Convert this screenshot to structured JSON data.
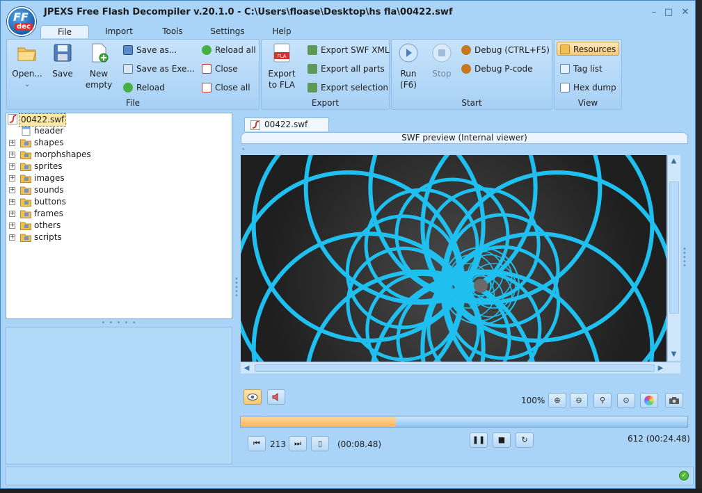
{
  "window": {
    "title": "JPEXS Free Flash Decompiler v.20.1.0 - C:\\Users\\floase\\Desktop\\hs fla\\00422.swf",
    "logo_top": "FF",
    "logo_bottom": "dec",
    "minimize_glyph": "–",
    "maximize_glyph": "□",
    "close_glyph": "✕"
  },
  "tabs": [
    {
      "label": "File",
      "active": true
    },
    {
      "label": "Import",
      "active": false
    },
    {
      "label": "Tools",
      "active": false
    },
    {
      "label": "Settings",
      "active": false
    },
    {
      "label": "Help",
      "active": false
    }
  ],
  "ribbon": {
    "file": {
      "label": "File",
      "open": "Open...",
      "save": "Save",
      "new_line1": "New",
      "new_line2": "empty",
      "save_as": "Save as...",
      "save_as_exe": "Save as Exe...",
      "reload": "Reload",
      "reload_all": "Reload all",
      "close": "Close",
      "close_all": "Close all"
    },
    "export": {
      "label": "Export",
      "fla_line1": "Export",
      "fla_line2": "to FLA",
      "fla_badge": "FLA",
      "swf_xml": "Export SWF XML",
      "all_parts": "Export all parts",
      "selection": "Export selection"
    },
    "start": {
      "label": "Start",
      "run_line1": "Run",
      "run_line2": "(F6)",
      "stop": "Stop",
      "debug": "Debug (CTRL+F5)",
      "debug_pcode": "Debug P-code"
    },
    "view": {
      "label": "View",
      "resources": "Resources",
      "tag_list": "Tag list",
      "hex_dump": "Hex dump"
    }
  },
  "tree": {
    "root": "00422.swf",
    "items": [
      {
        "label": "header",
        "icon": "header-icon",
        "expandable": false
      },
      {
        "label": "shapes",
        "icon": "shapes-folder-icon",
        "expandable": true
      },
      {
        "label": "morphshapes",
        "icon": "morphshapes-folder-icon",
        "expandable": true
      },
      {
        "label": "sprites",
        "icon": "sprites-folder-icon",
        "expandable": true
      },
      {
        "label": "images",
        "icon": "images-folder-icon",
        "expandable": true
      },
      {
        "label": "sounds",
        "icon": "sounds-folder-icon",
        "expandable": true
      },
      {
        "label": "buttons",
        "icon": "buttons-folder-icon",
        "expandable": true
      },
      {
        "label": "frames",
        "icon": "frames-folder-icon",
        "expandable": true
      },
      {
        "label": "others",
        "icon": "others-folder-icon",
        "expandable": true
      },
      {
        "label": "scripts",
        "icon": "scripts-folder-icon",
        "expandable": true
      }
    ]
  },
  "preview": {
    "doc_tab": "00422.swf",
    "title": "SWF preview (Internal viewer)",
    "marker": "-",
    "zoom": "100%",
    "stage_colors": {
      "line": "#1fc0ef",
      "bg": "#2b2b2b"
    }
  },
  "playback": {
    "current_frame": "213",
    "current_time": "(00:08.48)",
    "total": "612  (00:24.48)",
    "progress_fraction": 0.348
  },
  "colors": {
    "window_bg": "#a9d3f7",
    "accent_orange": "#f5b660",
    "status_ok": "#4ebd3a"
  }
}
